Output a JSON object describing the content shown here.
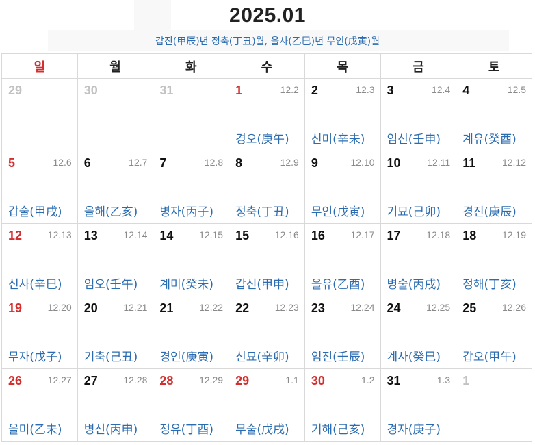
{
  "header": {
    "title": "2025.01",
    "subtitle": "갑진(甲辰)년 정축(丁丑)월, 을사(乙巳)년 무인(戊寅)월"
  },
  "colors": {
    "sunday": "#d42f2f",
    "holiday": "#d42f2f",
    "ganji": "#2b6cb0",
    "lunar": "#8a8a8a",
    "other_month": "#c2c2c2"
  },
  "weekdays": [
    {
      "label": "일",
      "sunday": true
    },
    {
      "label": "월"
    },
    {
      "label": "화"
    },
    {
      "label": "수"
    },
    {
      "label": "목"
    },
    {
      "label": "금"
    },
    {
      "label": "토"
    }
  ],
  "weeks": [
    [
      {
        "day": "29",
        "style": "grey"
      },
      {
        "day": "30",
        "style": "grey"
      },
      {
        "day": "31",
        "style": "grey"
      },
      {
        "day": "1",
        "lunar": "12.2",
        "ganji": "경오(庚午)",
        "style": "red"
      },
      {
        "day": "2",
        "lunar": "12.3",
        "ganji": "신미(辛未)"
      },
      {
        "day": "3",
        "lunar": "12.4",
        "ganji": "임신(壬申)"
      },
      {
        "day": "4",
        "lunar": "12.5",
        "ganji": "계유(癸酉)"
      }
    ],
    [
      {
        "day": "5",
        "lunar": "12.6",
        "ganji": "갑술(甲戌)",
        "style": "red"
      },
      {
        "day": "6",
        "lunar": "12.7",
        "ganji": "을해(乙亥)"
      },
      {
        "day": "7",
        "lunar": "12.8",
        "ganji": "병자(丙子)"
      },
      {
        "day": "8",
        "lunar": "12.9",
        "ganji": "정축(丁丑)"
      },
      {
        "day": "9",
        "lunar": "12.10",
        "ganji": "무인(戊寅)"
      },
      {
        "day": "10",
        "lunar": "12.11",
        "ganji": "기묘(己卯)"
      },
      {
        "day": "11",
        "lunar": "12.12",
        "ganji": "경진(庚辰)"
      }
    ],
    [
      {
        "day": "12",
        "lunar": "12.13",
        "ganji": "신사(辛巳)",
        "style": "red"
      },
      {
        "day": "13",
        "lunar": "12.14",
        "ganji": "임오(壬午)"
      },
      {
        "day": "14",
        "lunar": "12.15",
        "ganji": "계미(癸未)"
      },
      {
        "day": "15",
        "lunar": "12.16",
        "ganji": "갑신(甲申)"
      },
      {
        "day": "16",
        "lunar": "12.17",
        "ganji": "을유(乙酉)"
      },
      {
        "day": "17",
        "lunar": "12.18",
        "ganji": "병술(丙戌)"
      },
      {
        "day": "18",
        "lunar": "12.19",
        "ganji": "정해(丁亥)"
      }
    ],
    [
      {
        "day": "19",
        "lunar": "12.20",
        "ganji": "무자(戊子)",
        "style": "red"
      },
      {
        "day": "20",
        "lunar": "12.21",
        "ganji": "기축(己丑)"
      },
      {
        "day": "21",
        "lunar": "12.22",
        "ganji": "경인(庚寅)"
      },
      {
        "day": "22",
        "lunar": "12.23",
        "ganji": "신묘(辛卯)"
      },
      {
        "day": "23",
        "lunar": "12.24",
        "ganji": "임진(壬辰)"
      },
      {
        "day": "24",
        "lunar": "12.25",
        "ganji": "계사(癸巳)"
      },
      {
        "day": "25",
        "lunar": "12.26",
        "ganji": "갑오(甲午)"
      }
    ],
    [
      {
        "day": "26",
        "lunar": "12.27",
        "ganji": "을미(乙未)",
        "style": "red"
      },
      {
        "day": "27",
        "lunar": "12.28",
        "ganji": "병신(丙申)"
      },
      {
        "day": "28",
        "lunar": "12.29",
        "ganji": "정유(丁酉)",
        "style": "red"
      },
      {
        "day": "29",
        "lunar": "1.1",
        "ganji": "무술(戊戌)",
        "style": "red"
      },
      {
        "day": "30",
        "lunar": "1.2",
        "ganji": "기해(己亥)",
        "style": "red"
      },
      {
        "day": "31",
        "lunar": "1.3",
        "ganji": "경자(庚子)"
      },
      {
        "day": "1",
        "style": "grey"
      }
    ]
  ]
}
